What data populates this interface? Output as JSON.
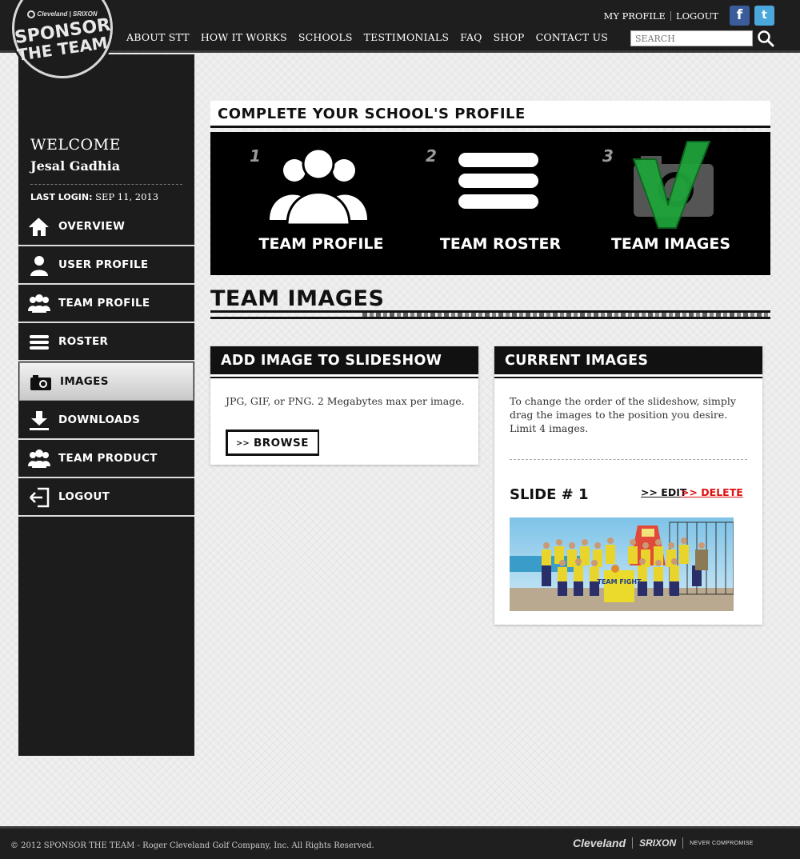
{
  "header": {
    "logo": {
      "brand_left": "Cleveland",
      "brand_right": "SRIXON",
      "line1": "SPONSOR",
      "line2": "THE TEAM"
    },
    "nav": [
      "ABOUT STT",
      "HOW IT WORKS",
      "SCHOOLS",
      "TESTIMONIALS",
      "FAQ",
      "SHOP",
      "CONTACT US"
    ],
    "my_profile": "MY PROFILE",
    "logout": "LOGOUT",
    "search_placeholder": "SEARCH",
    "colors": {
      "facebook": "#3b5c9a",
      "twitter": "#4aa8dc"
    }
  },
  "sidebar": {
    "welcome": "WELCOME",
    "user_name": "Jesal Gadhia",
    "last_login_label": "LAST LOGIN:",
    "last_login_value": "SEP 11, 2013",
    "items": [
      {
        "label": "OVERVIEW",
        "icon": "home-icon"
      },
      {
        "label": "USER PROFILE",
        "icon": "user-icon"
      },
      {
        "label": "TEAM PROFILE",
        "icon": "team-icon"
      },
      {
        "label": "ROSTER",
        "icon": "list-icon"
      },
      {
        "label": "IMAGES",
        "icon": "camera-icon",
        "active": true
      },
      {
        "label": "DOWNLOADS",
        "icon": "download-icon"
      },
      {
        "label": "TEAM PRODUCT",
        "icon": "team-icon"
      },
      {
        "label": "LOGOUT",
        "icon": "logout-icon"
      }
    ]
  },
  "main": {
    "profile_steps_title": "COMPLETE YOUR SCHOOL'S PROFILE",
    "steps": [
      {
        "number": "1",
        "label": "TEAM PROFILE",
        "icon": "team-icon"
      },
      {
        "number": "2",
        "label": "TEAM ROSTER",
        "icon": "list-icon"
      },
      {
        "number": "3",
        "label": "TEAM IMAGES",
        "icon": "camera-checkmark-icon"
      }
    ],
    "page_title": "TEAM IMAGES",
    "add_panel": {
      "title": "ADD IMAGE TO SLIDESHOW",
      "help": "JPG, GIF, or PNG. 2 Megabytes max per image.",
      "browse_arrow": ">>",
      "browse_label": "BROWSE"
    },
    "current_panel": {
      "title": "CURRENT IMAGES",
      "help": "To change the order of the slideshow, simply drag the images to the position you desire. Limit 4 images.",
      "slides": [
        {
          "label": "SLIDE # 1",
          "edit": ">> EDIT",
          "delete": ">> DELETE",
          "image": "team-photo",
          "banner_text": "TEAM FIGHT"
        }
      ],
      "colors": {
        "delete": "#dd1111"
      }
    }
  },
  "footer": {
    "copyright": "© 2012 SPONSOR THE TEAM - Roger Cleveland Golf Company, Inc. All Rights Reserved.",
    "brand1": "Cleveland",
    "brand2": "SRIXON",
    "brand3": "NEVER COMPROMISE"
  }
}
